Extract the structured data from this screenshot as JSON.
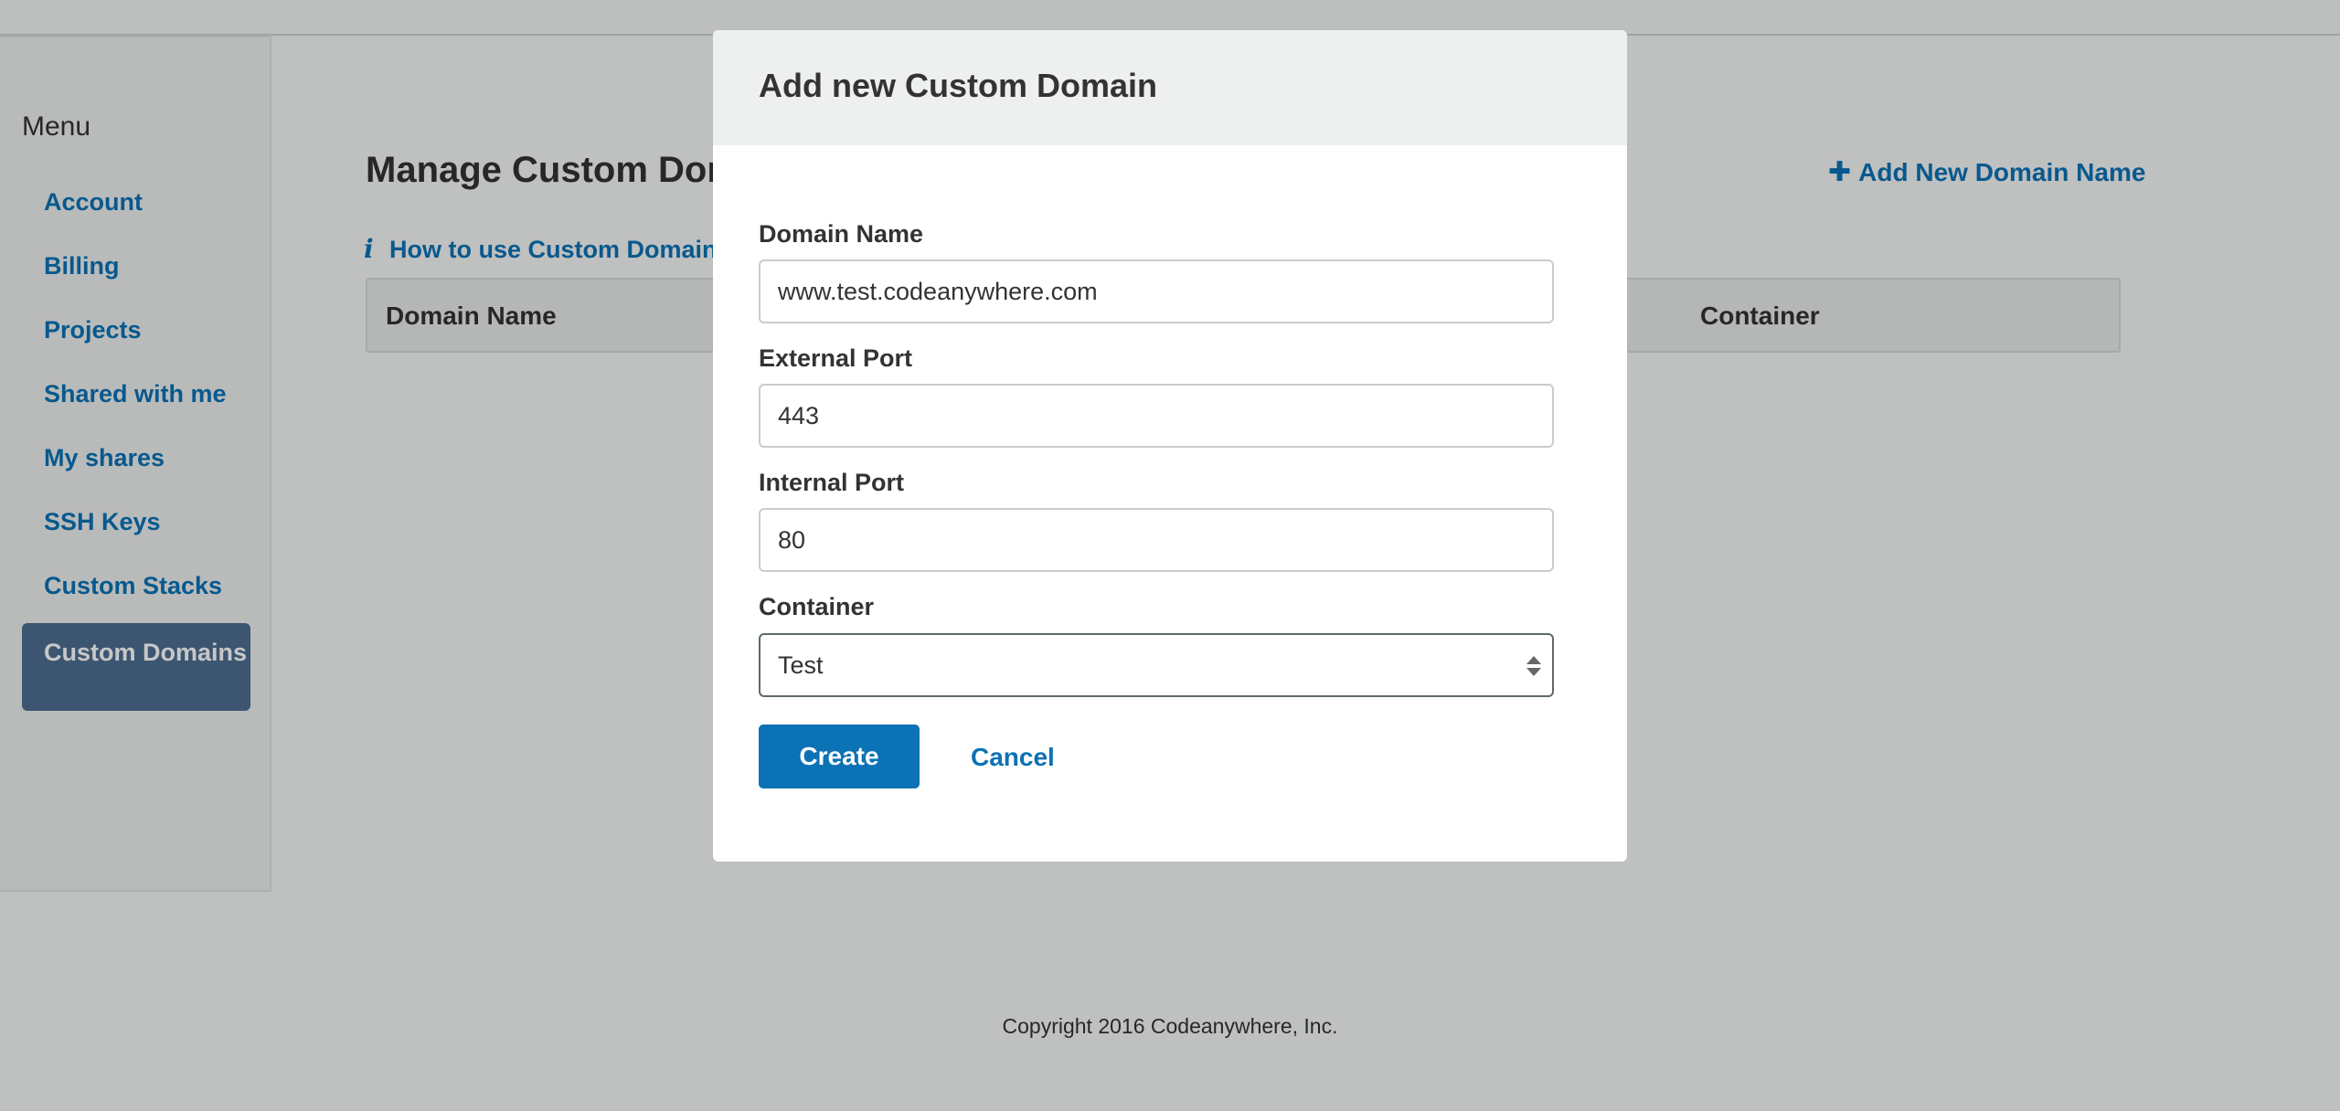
{
  "sidebar": {
    "title": "Menu",
    "items": [
      {
        "label": "Account"
      },
      {
        "label": "Billing"
      },
      {
        "label": "Projects"
      },
      {
        "label": "Shared with me"
      },
      {
        "label": "My shares"
      },
      {
        "label": "SSH Keys"
      },
      {
        "label": "Custom Stacks"
      },
      {
        "label": "Custom Domains",
        "active": true
      }
    ],
    "active_color": "#4d6e91"
  },
  "main": {
    "title": "Manage Custom Domains",
    "howto_link": "How to use Custom Domains",
    "add_new_link": "Add New Domain Name",
    "table": {
      "columns": [
        "Domain Name",
        "Container"
      ]
    }
  },
  "footer": {
    "copyright": "Copyright 2016 Codeanywhere, Inc."
  },
  "modal": {
    "title": "Add new Custom Domain",
    "fields": {
      "domain_name": {
        "label": "Domain Name",
        "value": "www.test.codeanywhere.com"
      },
      "external_port": {
        "label": "External Port",
        "value": "443"
      },
      "internal_port": {
        "label": "Internal Port",
        "value": "80"
      },
      "container": {
        "label": "Container",
        "selected": "Test"
      }
    },
    "create_label": "Create",
    "cancel_label": "Cancel"
  },
  "colors": {
    "link": "#0b72b5",
    "primary_button": "#0b72b5"
  },
  "icons": {
    "howto": "info-icon",
    "add_new": "plus-icon",
    "select": "sort-arrows-icon"
  }
}
